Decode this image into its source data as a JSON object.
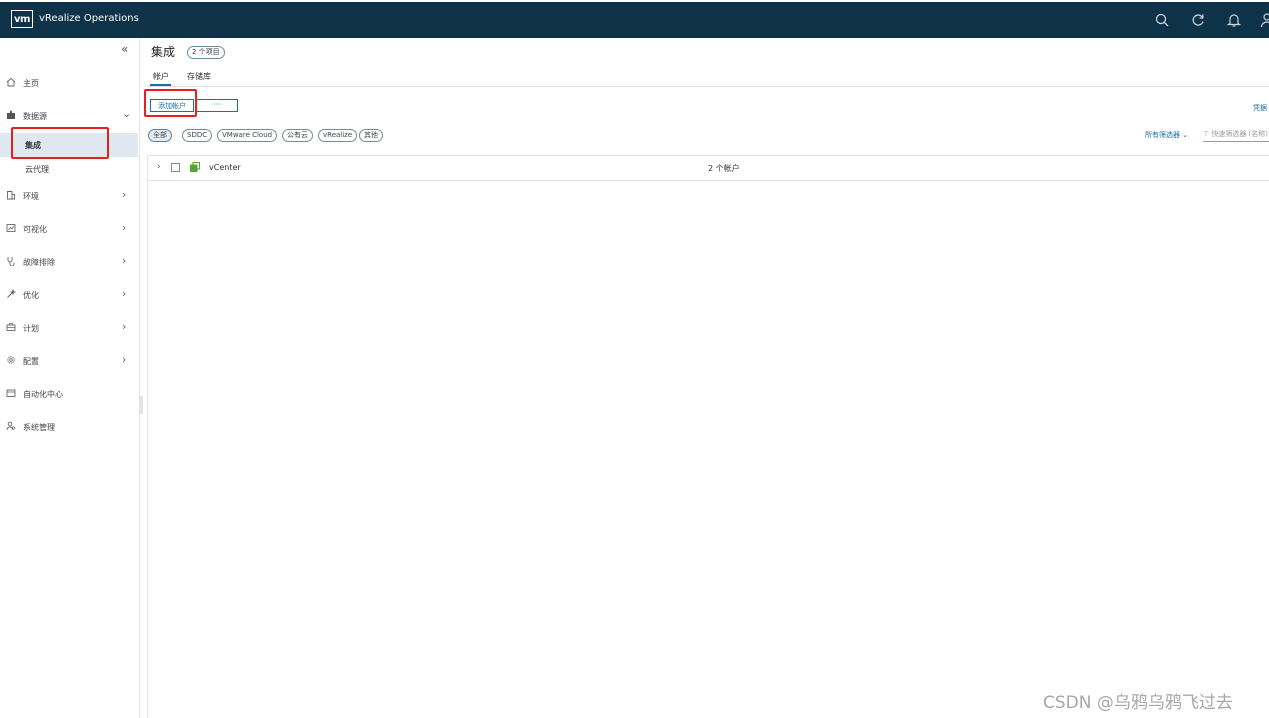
{
  "header": {
    "logo": "vm",
    "title": "vRealize Operations",
    "icons": [
      "search-icon",
      "refresh-icon",
      "bell-icon",
      "user-icon"
    ]
  },
  "sidebar": {
    "collapse_icon": "«",
    "items": [
      {
        "label": "主页",
        "icon": "home-icon"
      },
      {
        "label": "数据源",
        "icon": "puzzle-icon",
        "expanded": true
      },
      {
        "label": "环境",
        "icon": "building-icon"
      },
      {
        "label": "可视化",
        "icon": "chart-icon"
      },
      {
        "label": "故障排除",
        "icon": "stethoscope-icon"
      },
      {
        "label": "优化",
        "icon": "wand-icon"
      },
      {
        "label": "计划",
        "icon": "briefcase-icon"
      },
      {
        "label": "配置",
        "icon": "gear-icon"
      },
      {
        "label": "自动化中心",
        "icon": "calendar-icon"
      },
      {
        "label": "系统管理",
        "icon": "admin-icon"
      }
    ],
    "subitems": [
      {
        "label": "集成",
        "active": true
      },
      {
        "label": "云代理",
        "active": false
      }
    ]
  },
  "main": {
    "title": "集成",
    "count_badge": "2 个项目",
    "tabs": [
      {
        "label": "帐户",
        "active": true
      },
      {
        "label": "存储库",
        "active": false
      }
    ],
    "toolbar": {
      "add_label": "添加帐户",
      "more_label": "···",
      "credentials_link": "凭据"
    },
    "filter_chips": [
      "全部",
      "SDDC",
      "VMware Cloud",
      "公有云",
      "vRealize",
      "其他"
    ],
    "all_filters_label": "所有筛选器 ⌄",
    "quick_filter_placeholder": "⊤ 快速筛选器 (名称)",
    "rows": [
      {
        "name": "vCenter",
        "count": "2 个帐户"
      }
    ]
  },
  "watermark": "CSDN @乌鸦乌鸦飞过去",
  "colors": {
    "header_bg": "#0e3247",
    "accent": "#1b6fa8",
    "highlight_box": "#e8201c",
    "vcenter_icon": "#5aa52c"
  }
}
